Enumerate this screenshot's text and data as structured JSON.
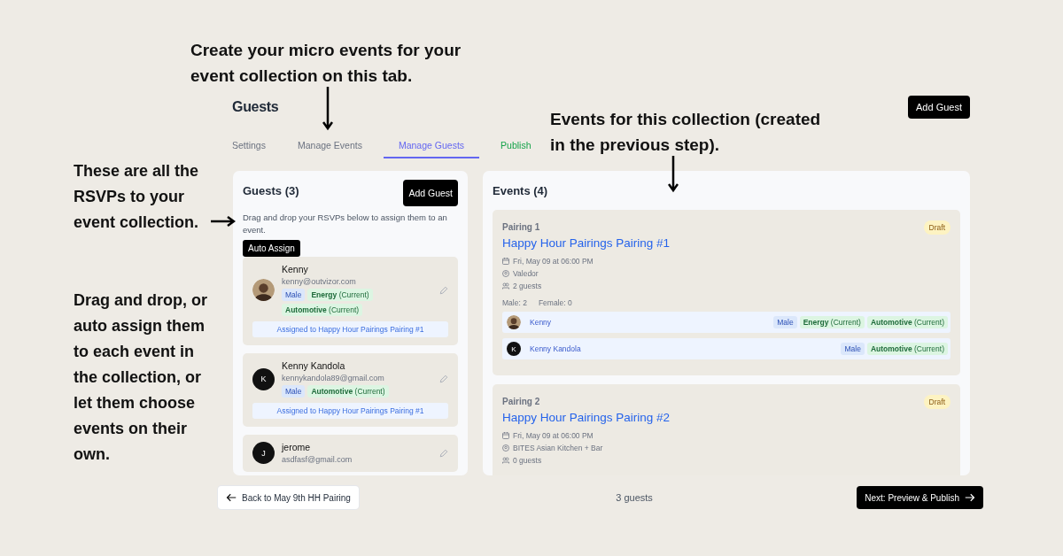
{
  "annotations": [
    {
      "text": "Create your micro events for your event collection on this tab."
    },
    {
      "text": "Events for this collection (created in the previous step)."
    },
    {
      "text": "These are all the RSVPs to your event collection."
    },
    {
      "text": "Drag and drop, or auto assign them to each event in the collection, or let them choose events on their own."
    }
  ],
  "app": {
    "title": "Guests",
    "header_button": "Add Guest",
    "tabs": [
      {
        "label": "Settings",
        "selected": false,
        "color": "#6b7280"
      },
      {
        "label": "Manage Events",
        "selected": false,
        "color": "#6b7280"
      },
      {
        "label": "Manage Guests",
        "selected": true,
        "color": "#6366f1"
      },
      {
        "label": "Publish",
        "selected": false,
        "color": "#16a34a"
      }
    ],
    "guests_panel": {
      "title": "Guests (3)",
      "add_button": "Add Guest",
      "hint": "Drag and drop your RSVPs below to assign them to an event.",
      "auto_assign": "Auto Assign",
      "guests": [
        {
          "name": "Kenny",
          "email": "kenny@outvizor.com",
          "tags": [
            {
              "label": "Male",
              "kind": "gender"
            },
            {
              "label": "**Energy** (Current)",
              "kind": "industry"
            },
            {
              "label": "**Automotive** (Current)",
              "kind": "industry"
            }
          ],
          "assignment": "Assigned to Happy Hour Pairings Pairing #1"
        },
        {
          "name": "Kenny Kandola",
          "email": "kennykandola89@gmail.com",
          "initial": "K",
          "tags": [
            {
              "label": "Male",
              "kind": "gender"
            },
            {
              "label": "**Automotive** (Current)",
              "kind": "industry"
            }
          ],
          "assignment": "Assigned to Happy Hour Pairings Pairing #1"
        },
        {
          "name": "jerome",
          "email": "asdfasf@gmail.com",
          "initial": "J"
        }
      ]
    },
    "events_panel": {
      "title": "Events (4)",
      "events": [
        {
          "label": "Pairing 1",
          "status": "Draft",
          "title": "Happy Hour Pairings Pairing #1",
          "date": "Fri, May 09 at 06:00 PM",
          "venue": "Valedor",
          "guest_count": "2 guests",
          "stats": [
            "Male: 2",
            "Female: 0"
          ],
          "attendees": [
            {
              "name": "Kenny",
              "tags": [
                {
                  "label": "Male",
                  "kind": "gender"
                },
                {
                  "label": "**Energy** (Current)",
                  "kind": "industry"
                },
                {
                  "label": "**Automotive** (Current)",
                  "kind": "industry"
                }
              ]
            },
            {
              "name": "Kenny Kandola",
              "initial": "K",
              "tags": [
                {
                  "label": "Male",
                  "kind": "gender"
                },
                {
                  "label": "**Automotive** (Current)",
                  "kind": "industry"
                }
              ]
            }
          ]
        },
        {
          "label": "Pairing 2",
          "status": "Draft",
          "title": "Happy Hour Pairings Pairing #2",
          "date": "Fri, May 09 at 06:00 PM",
          "venue": "BITES Asian Kitchen + Bar",
          "guest_count": "0 guests"
        }
      ]
    },
    "footer": {
      "back": "Back to May 9th HH Pairing",
      "count": "3 guests",
      "next": "Next: Preview & Publish"
    }
  }
}
